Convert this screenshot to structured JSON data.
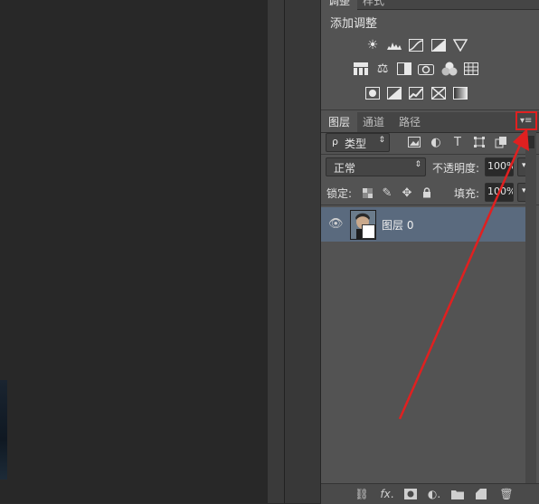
{
  "adjustments_panel": {
    "tabs": [
      {
        "label": "调整",
        "active": true
      },
      {
        "label": "样式",
        "active": false
      }
    ],
    "title": "添加调整",
    "icons_row1": [
      "brightness-icon",
      "levels-icon",
      "curves-icon",
      "exposure-icon",
      "vibrance-icon"
    ],
    "icons_row2": [
      "hue-saturation-icon",
      "color-balance-icon",
      "black-white-icon",
      "photo-filter-icon",
      "channel-mixer-icon",
      "color-lookup-icon"
    ],
    "icons_row3": [
      "invert-icon",
      "posterize-icon",
      "threshold-icon",
      "selective-color-icon",
      "gradient-map-icon"
    ]
  },
  "layers_panel": {
    "tabs": [
      {
        "label": "图层",
        "active": true
      },
      {
        "label": "通道",
        "active": false
      },
      {
        "label": "路径",
        "active": false
      }
    ],
    "filter_label": "类型",
    "filter_prefix": "ρ",
    "blend_mode": "正常",
    "opacity_label": "不透明度:",
    "opacity_value": "100%",
    "lock_label": "锁定:",
    "fill_label": "填充:",
    "fill_value": "100%",
    "layers": [
      {
        "name": "图层 0",
        "visible": true,
        "selected": true
      }
    ]
  },
  "colors": {
    "panel_bg": "#535353",
    "selected_layer": "#5a6a7e",
    "annotation_red": "#e02020"
  }
}
